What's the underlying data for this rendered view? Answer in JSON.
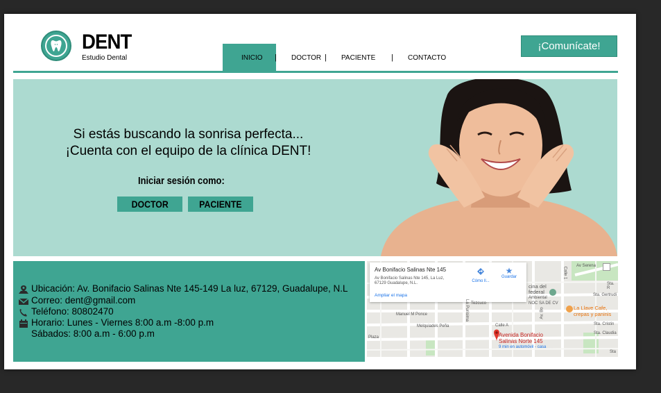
{
  "header": {
    "brand": "DENT",
    "brand_sub": "Estudio Dental",
    "nav": [
      "INICIO",
      "DOCTOR",
      "PACIENTE",
      "CONTACTO"
    ],
    "cta": "¡Comunícate!"
  },
  "hero": {
    "line1": "Si estás buscando la sonrisa perfecta...",
    "line2": "¡Cuenta con el equipo de la clínica DENT!",
    "login_label": "Iniciar sesión como:",
    "doctor_button": "DOCTOR",
    "patient_button": "PACIENTE"
  },
  "contact": {
    "location": "Ubicación: Av. Bonifacio Salinas Nte 145-149 La luz, 67129, Guadalupe, N.L",
    "email": "Correo: dent@gmail.com",
    "phone": "Teléfono: 80802470",
    "hours": "Horario: Lunes - Viernes 8:00 a.m -8:00 p.m",
    "saturday": "Sábados: 8:00 a.m - 6:00 p.m"
  },
  "map": {
    "title": "Av Bonifacio Salinas Nte 145",
    "address1": "Av Bonifacio Salinas Nte 145, La Luz,",
    "address2": "67129 Guadalupe, N.L.",
    "directions": "Cómo ll...",
    "save": "Guardar",
    "expand": "Ampliar el mapa",
    "pin_label1": "Avenida Bonifacio",
    "pin_label2": "Salinas Norte 145",
    "pin_time": "9 min en automóvil - casa",
    "poi": "La Llave Cafe,",
    "poi2": "crepas y paninis",
    "oficina1": "cina del",
    "oficina2": "federal",
    "oficina3": "Ambiental",
    "oficina4": "NOC SA DE CV",
    "streets": [
      "Melquiades Peña",
      "Manuel M Ponce",
      "Calle A",
      "Av Serena",
      "Sta. Gertrudi",
      "Sta. Cristin",
      "Sta. Claudia",
      "Plaza",
      "Tezcuco",
      "La Purísima",
      "Av. Bo",
      "Calle 1",
      "Sta",
      "Sta. R"
    ]
  }
}
